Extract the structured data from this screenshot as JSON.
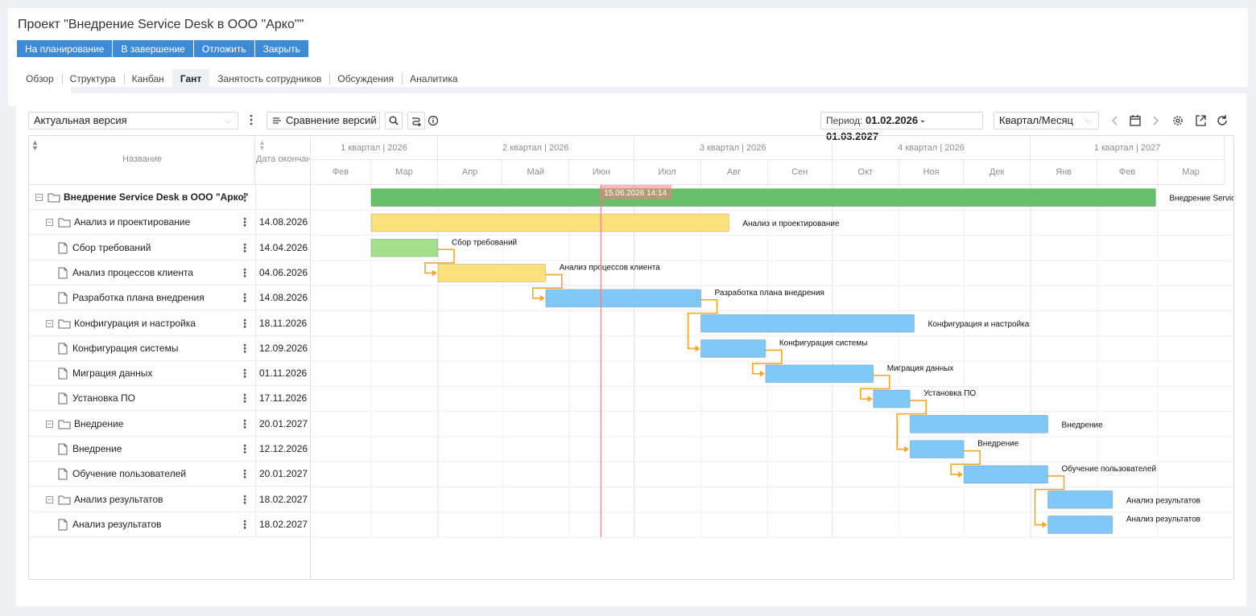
{
  "header": {
    "title": "Проект \"Внедрение Service Desk в ООО \"Арко\"\"",
    "actions": [
      "На планирование",
      "В завершение",
      "Отложить",
      "Закрыть"
    ]
  },
  "tabs": [
    {
      "label": "Обзор"
    },
    {
      "label": "Структура"
    },
    {
      "label": "Канбан"
    },
    {
      "label": "Гант",
      "active": true
    },
    {
      "label": "Занятость сотрудников"
    },
    {
      "label": "Обсуждения"
    },
    {
      "label": "Аналитика"
    }
  ],
  "toolbar": {
    "version_select": "Актуальная версия",
    "compare_label": "Сравнение версий",
    "period_label": "Период:",
    "period_value": "01.02.2026 - 01.03.2027",
    "scale_select": "Квартал/Месяц",
    "icons": [
      "more-vertical-icon",
      "compare-icon",
      "search-icon",
      "link-icon",
      "info-icon",
      "chevron-left-icon",
      "calendar-icon",
      "chevron-right-icon",
      "gear-icon",
      "export-icon",
      "refresh-icon"
    ]
  },
  "grid": {
    "col_name": "Название",
    "col_date": "Дата окончания",
    "rows": [
      {
        "name": "Внедрение Service Desk в ООО \"Арко\"",
        "date": "",
        "level": 0,
        "type": "project",
        "bold": true
      },
      {
        "name": "Анализ и проектирование",
        "date": "14.08.2026",
        "level": 1,
        "type": "group"
      },
      {
        "name": "Сбор требований",
        "date": "14.04.2026",
        "level": 2,
        "type": "task"
      },
      {
        "name": "Анализ процессов клиента",
        "date": "04.06.2026",
        "level": 2,
        "type": "task"
      },
      {
        "name": "Разработка плана внедрения",
        "date": "14.08.2026",
        "level": 2,
        "type": "task"
      },
      {
        "name": "Конфигурация и настройка",
        "date": "18.11.2026",
        "level": 1,
        "type": "group"
      },
      {
        "name": "Конфигурация системы",
        "date": "12.09.2026",
        "level": 2,
        "type": "task"
      },
      {
        "name": "Миграция данных",
        "date": "01.11.2026",
        "level": 2,
        "type": "task"
      },
      {
        "name": "Установка ПО",
        "date": "17.11.2026",
        "level": 2,
        "type": "task"
      },
      {
        "name": "Внедрение",
        "date": "20.01.2027",
        "level": 1,
        "type": "group"
      },
      {
        "name": "Внедрение",
        "date": "12.12.2026",
        "level": 2,
        "type": "task"
      },
      {
        "name": "Обучение пользователей",
        "date": "20.01.2027",
        "level": 2,
        "type": "task"
      },
      {
        "name": "Анализ результатов",
        "date": "18.02.2027",
        "level": 1,
        "type": "group"
      },
      {
        "name": "Анализ результатов",
        "date": "18.02.2027",
        "level": 2,
        "type": "task"
      }
    ]
  },
  "timeline": {
    "quarters": [
      "1 квартал | 2026",
      "2 квартал | 2026",
      "3 квартал | 2026",
      "4 квартал | 2026",
      "1 квартал | 2027"
    ],
    "months": [
      "Фев",
      "Мар",
      "Апр",
      "Май",
      "Июн",
      "Июл",
      "Авг",
      "Сен",
      "Окт",
      "Ноя",
      "Дек",
      "Янв",
      "Фев",
      "Мар"
    ],
    "today_label": "15.06.2026 14:14",
    "bars": [
      {
        "label": "Внедрение Service Desk в ООО \"Арко\"",
        "start": "2026-03-01",
        "end": "2027-02-28",
        "color": "#66bf6a"
      },
      {
        "label": "Анализ и проектирование",
        "start": "2026-03-01",
        "end": "2026-08-14",
        "color": "#fbe07c"
      },
      {
        "label": "Сбор требований",
        "start": "2026-03-01",
        "end": "2026-04-01",
        "color": "#a3df8c"
      },
      {
        "label": "Анализ процессов клиента",
        "start": "2026-04-01",
        "end": "2026-05-21",
        "color": "#fbe07c"
      },
      {
        "label": "Разработка плана внедрения",
        "start": "2026-05-21",
        "end": "2026-08-01",
        "color": "#7fc8f8"
      },
      {
        "label": "Конфигурация и настройка",
        "start": "2026-08-01",
        "end": "2026-11-08",
        "color": "#7fc8f8"
      },
      {
        "label": "Конфигурация системы",
        "start": "2026-08-01",
        "end": "2026-08-31",
        "color": "#7fc8f8"
      },
      {
        "label": "Миграция данных",
        "start": "2026-08-31",
        "end": "2026-10-20",
        "color": "#7fc8f8"
      },
      {
        "label": "Установка ПО",
        "start": "2026-10-20",
        "end": "2026-11-06",
        "color": "#7fc8f8"
      },
      {
        "label": "Внедрение",
        "start": "2026-11-06",
        "end": "2027-01-09",
        "color": "#7fc8f8"
      },
      {
        "label": "Внедрение",
        "start": "2026-11-06",
        "end": "2026-12-01",
        "color": "#7fc8f8"
      },
      {
        "label": "Обучение пользователей",
        "start": "2026-12-01",
        "end": "2027-01-09",
        "color": "#7fc8f8"
      },
      {
        "label": "Анализ результатов",
        "start": "2027-01-09",
        "end": "2027-02-08",
        "color": "#7fc8f8"
      },
      {
        "label": "Анализ результатов",
        "start": "2027-01-09",
        "end": "2027-02-08",
        "color": "#7fc8f8"
      }
    ],
    "dependencies": [
      [
        2,
        3
      ],
      [
        3,
        4
      ],
      [
        4,
        6
      ],
      [
        6,
        7
      ],
      [
        7,
        8
      ],
      [
        8,
        10
      ],
      [
        10,
        11
      ],
      [
        11,
        13
      ]
    ],
    "dependency_color": "#f5a623",
    "today_color": "#f08080"
  }
}
